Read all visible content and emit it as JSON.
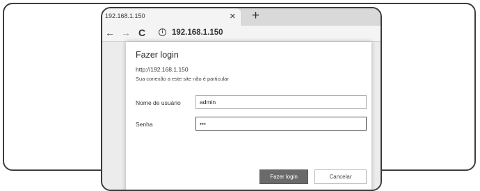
{
  "browser": {
    "tab_title": "192.168.1.150",
    "tab_close": "×",
    "new_tab": "+",
    "address": "192.168.1.150",
    "nav": {
      "back": "←",
      "forward": "→",
      "reload": "C",
      "info": "i"
    }
  },
  "dialog": {
    "title": "Fazer login",
    "url": "http://192.168.1.150",
    "warning": "Sua conexão a este site não é particular",
    "username_label": "Nome de usuário",
    "username_value": "admin",
    "password_label": "Senha",
    "password_value": "•••",
    "login_button": "Fazer login",
    "cancel_button": "Cancelar"
  }
}
